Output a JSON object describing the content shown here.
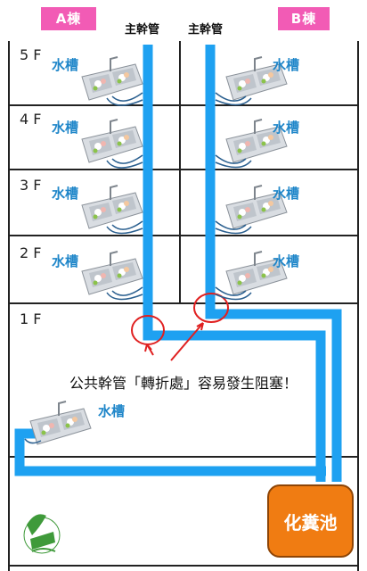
{
  "buildings": {
    "a": "A棟",
    "b": "B棟"
  },
  "main_pipe_label": "主幹管",
  "floors": [
    "5 F",
    "4 F",
    "3 F",
    "2 F",
    "1 F"
  ],
  "sink_label": "水槽",
  "note": "公共幹管「轉折處」容易發生阻塞！",
  "tank_label": "化糞池",
  "colors": {
    "pipe": "#1ea1f1",
    "tank": "#f07c12",
    "label_bg": "#f25bb5",
    "sink_text": "#1f86c9",
    "highlight": "#e02020"
  },
  "icons": [
    "sink-icon",
    "logo-icon"
  ]
}
